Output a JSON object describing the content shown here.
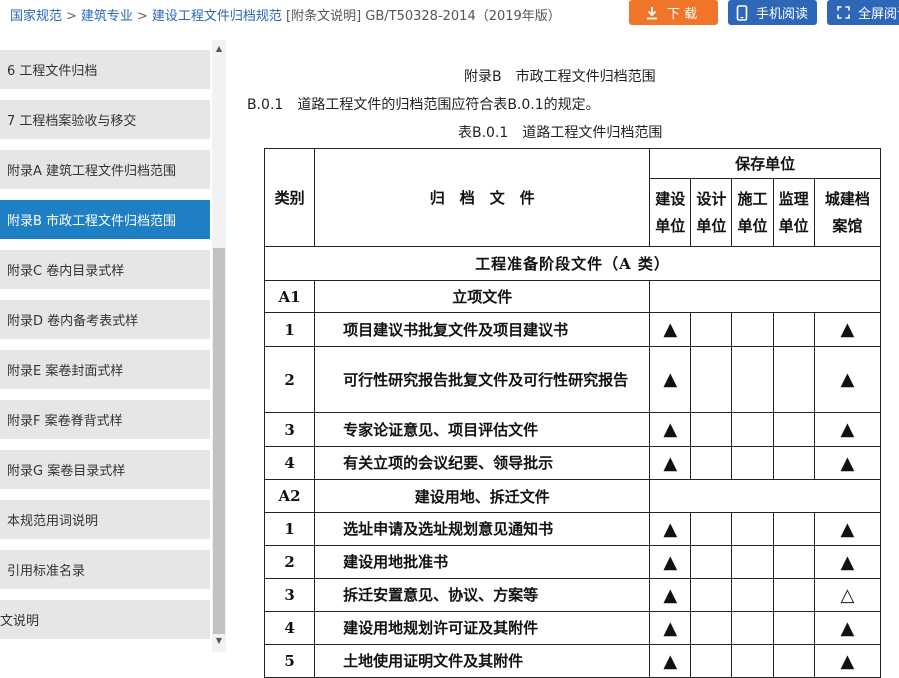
{
  "breadcrumb": {
    "items": [
      "国家规范",
      "建筑专业",
      "建设工程文件归档规范"
    ],
    "current": "[附条文说明] GB/T50328-2014（2019年版）",
    "separator": ">"
  },
  "toolbar": {
    "download": "下 载",
    "mobile": "手机阅读",
    "fullscreen": "全屏阅读"
  },
  "sidebar": {
    "items": [
      {
        "label": "6 工程文件归档"
      },
      {
        "label": "7 工程档案验收与移交"
      },
      {
        "label": "附录A 建筑工程文件归档范围"
      },
      {
        "label": "附录B 市政工程文件归档范围"
      },
      {
        "label": "附录C 卷内目录式样"
      },
      {
        "label": "附录D 卷内备考表式样"
      },
      {
        "label": "附录E 案卷封面式样"
      },
      {
        "label": "附录F 案卷脊背式样"
      },
      {
        "label": "附录G 案卷目录式样"
      },
      {
        "label": "本规范用词说明"
      },
      {
        "label": "引用标准名录"
      },
      {
        "label": "文说明"
      }
    ],
    "active_index": 3
  },
  "content": {
    "appendix_title": "附录B　市政工程文件归档范围",
    "clause": "B.0.1　道路工程文件的归档范围应符合表B.0.1的规定。",
    "table_caption": "表B.0.1　道路工程文件归档范围"
  },
  "table": {
    "header": {
      "category": "类别",
      "document": "归　档　文　件",
      "unit_group": "保存单位",
      "units": [
        [
          "建设",
          "单位"
        ],
        [
          "设计",
          "单位"
        ],
        [
          "施工",
          "单位"
        ],
        [
          "监理",
          "单位"
        ],
        [
          "城建档",
          "案馆"
        ]
      ]
    },
    "stage": "工程准备阶段文件（A 类）",
    "groups": [
      {
        "code": "A1",
        "title": "立项文件",
        "rows": [
          {
            "no": "1",
            "doc": "项目建议书批复文件及项目建议书",
            "marks": [
              "▲",
              "",
              "",
              "",
              "▲"
            ]
          },
          {
            "no": "2",
            "doc": "可行性研究报告批复文件及可行性研究报告",
            "marks": [
              "▲",
              "",
              "",
              "",
              "▲"
            ]
          },
          {
            "no": "3",
            "doc": "专家论证意见、项目评估文件",
            "marks": [
              "▲",
              "",
              "",
              "",
              "▲"
            ]
          },
          {
            "no": "4",
            "doc": "有关立项的会议纪要、领导批示",
            "marks": [
              "▲",
              "",
              "",
              "",
              "▲"
            ]
          }
        ]
      },
      {
        "code": "A2",
        "title": "建设用地、拆迁文件",
        "rows": [
          {
            "no": "1",
            "doc": "选址申请及选址规划意见通知书",
            "marks": [
              "▲",
              "",
              "",
              "",
              "▲"
            ]
          },
          {
            "no": "2",
            "doc": "建设用地批准书",
            "marks": [
              "▲",
              "",
              "",
              "",
              "▲"
            ]
          },
          {
            "no": "3",
            "doc": "拆迁安置意见、协议、方案等",
            "marks": [
              "▲",
              "",
              "",
              "",
              "△"
            ]
          },
          {
            "no": "4",
            "doc": "建设用地规划许可证及其附件",
            "marks": [
              "▲",
              "",
              "",
              "",
              "▲"
            ]
          },
          {
            "no": "5",
            "doc": "土地使用证明文件及其附件",
            "marks": [
              "▲",
              "",
              "",
              "",
              "▲"
            ]
          }
        ]
      }
    ]
  },
  "colors": {
    "download_button": "#f0752a",
    "blue_button": "#2e67b8",
    "active_sidebar": "#1f7fc4",
    "sidebar_item": "#e6e6e6"
  }
}
